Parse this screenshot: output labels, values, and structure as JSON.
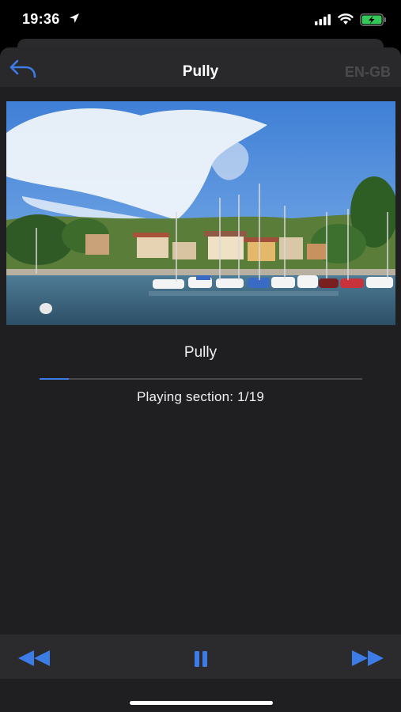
{
  "status_bar": {
    "time": "19:36",
    "location_icon": "location-arrow-icon",
    "signal_icon": "cellular-signal-icon",
    "wifi_icon": "wifi-icon",
    "battery_icon": "battery-charging-icon",
    "battery_color": "#34c759"
  },
  "nav": {
    "title": "Pully",
    "back_icon": "back-arrow-icon",
    "language": "EN-GB"
  },
  "media": {
    "image_alt": "Harbor with sailboats and lakeside town",
    "track_title": "Pully",
    "progress": 0.09,
    "section_label": "Playing section: 1/19"
  },
  "controls": {
    "rewind_icon": "rewind-icon",
    "pause_icon": "pause-icon",
    "forward_icon": "fast-forward-icon",
    "accent": "#3c7ce6"
  }
}
